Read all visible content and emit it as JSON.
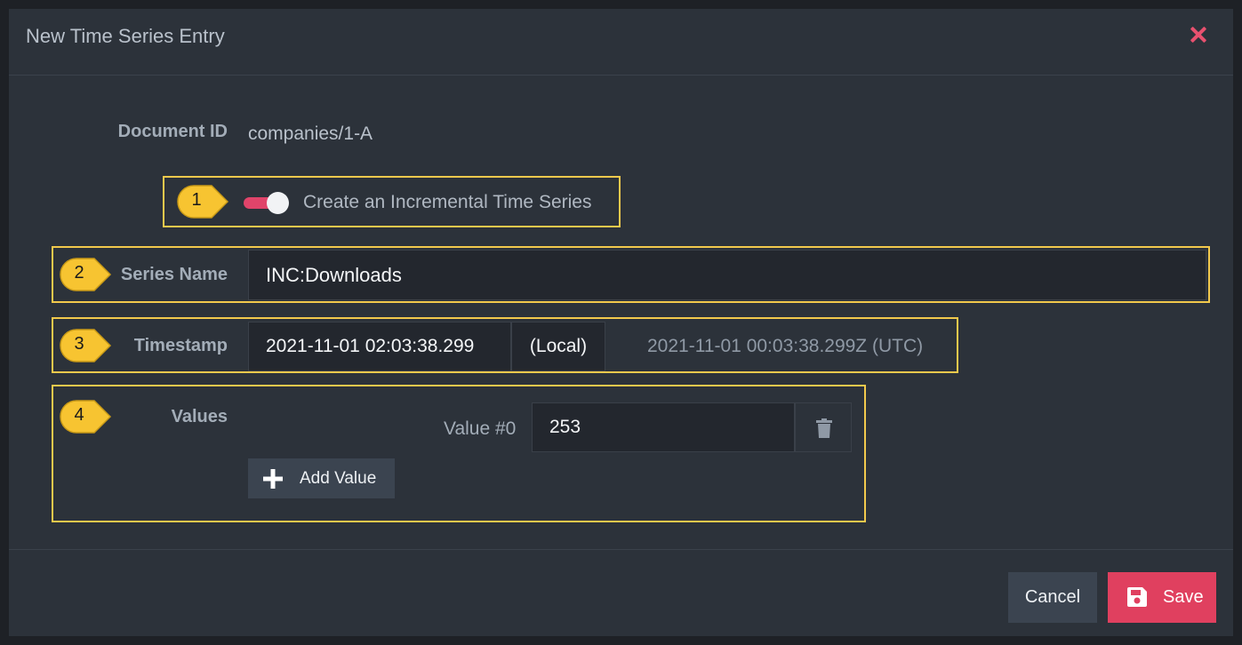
{
  "dialog": {
    "title": "New Time Series Entry"
  },
  "document": {
    "label": "Document ID",
    "value": "companies/1-A"
  },
  "incremental": {
    "label": "Create an Incremental Time Series",
    "enabled": true
  },
  "series": {
    "label": "Series Name",
    "value": "INC:Downloads"
  },
  "timestamp": {
    "label": "Timestamp",
    "value": "2021-11-01 02:03:38.299",
    "addon": "(Local)",
    "utc": "2021-11-01 00:03:38.299Z (UTC)"
  },
  "values": {
    "label": "Values",
    "items": [
      {
        "label": "Value #0",
        "value": "253"
      }
    ],
    "add_label": "Add Value"
  },
  "footer": {
    "cancel_label": "Cancel",
    "save_label": "Save"
  },
  "markers": [
    "1",
    "2",
    "3",
    "4"
  ],
  "colors": {
    "accent": "#e0405f",
    "highlight": "#f2c94c",
    "background": "#2c323a"
  }
}
